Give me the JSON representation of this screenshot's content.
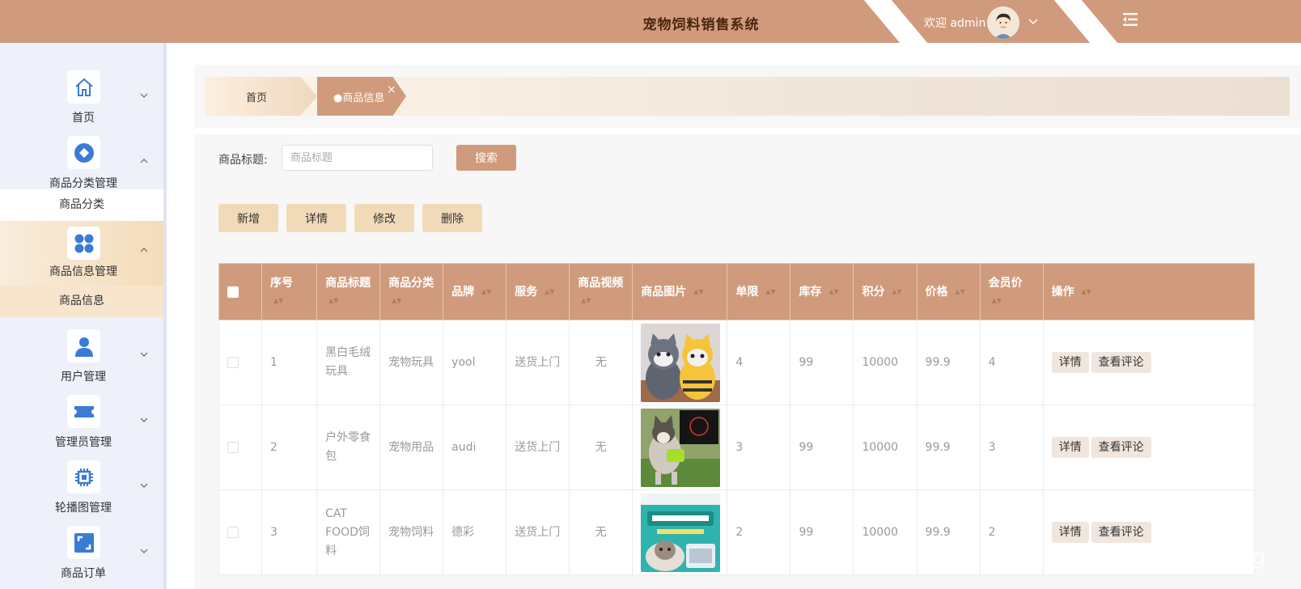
{
  "header": {
    "title": "宠物饲料销售系统",
    "welcome": "欢迎 admin",
    "accent_color": "#d09b7c"
  },
  "sidebar": {
    "items": [
      {
        "label": "首页",
        "icon": "home-icon",
        "expanded": false
      },
      {
        "label": "商品分类管理",
        "icon": "diamond-icon",
        "expanded": true,
        "sub": "商品分类"
      },
      {
        "label": "商品信息管理",
        "icon": "grid-icon",
        "expanded": true,
        "sub": "商品信息"
      },
      {
        "label": "用户管理",
        "icon": "user-icon",
        "expanded": false
      },
      {
        "label": "管理员管理",
        "icon": "ticket-icon",
        "expanded": false
      },
      {
        "label": "轮播图管理",
        "icon": "chip-icon",
        "expanded": false
      },
      {
        "label": "商品订单",
        "icon": "expand-icon",
        "expanded": false
      }
    ]
  },
  "tabs": {
    "home": "首页",
    "current": "●商品信息",
    "close": "×"
  },
  "search": {
    "label": "商品标题:",
    "placeholder": "商品标题",
    "button": "搜索"
  },
  "actions": {
    "add": "新增",
    "detail": "详情",
    "edit": "修改",
    "delete": "删除"
  },
  "table": {
    "headers": [
      "序号",
      "商品标题",
      "商品分类",
      "品牌",
      "服务",
      "商品视频",
      "商品图片",
      "单限",
      "库存",
      "积分",
      "价格",
      "会员价",
      "操作"
    ],
    "rows": [
      {
        "no": "1",
        "title": "黑白毛绒玩具",
        "category": "宠物玩具",
        "brand": "yool",
        "service": "送货上门",
        "video": "无",
        "image": "cat-plush-toys",
        "limit": "4",
        "stock": "99",
        "points": "10000",
        "price": "99.9",
        "vip_price": "4"
      },
      {
        "no": "2",
        "title": "户外零食包",
        "category": "宠物用品",
        "brand": "audi",
        "service": "送货上门",
        "video": "无",
        "image": "dog-snack-bag",
        "limit": "3",
        "stock": "99",
        "points": "10000",
        "price": "99.9",
        "vip_price": "3"
      },
      {
        "no": "3",
        "title": "CAT FOOD饲料",
        "category": "宠物饲料",
        "brand": "德彩",
        "service": "送货上门",
        "video": "无",
        "image": "cat-food-bag",
        "limit": "2",
        "stock": "99",
        "points": "10000",
        "price": "99.9",
        "vip_price": "2"
      }
    ],
    "op_detail": "详情",
    "op_review": "查看评论"
  },
  "watermark": "CSDN @森森 coding"
}
